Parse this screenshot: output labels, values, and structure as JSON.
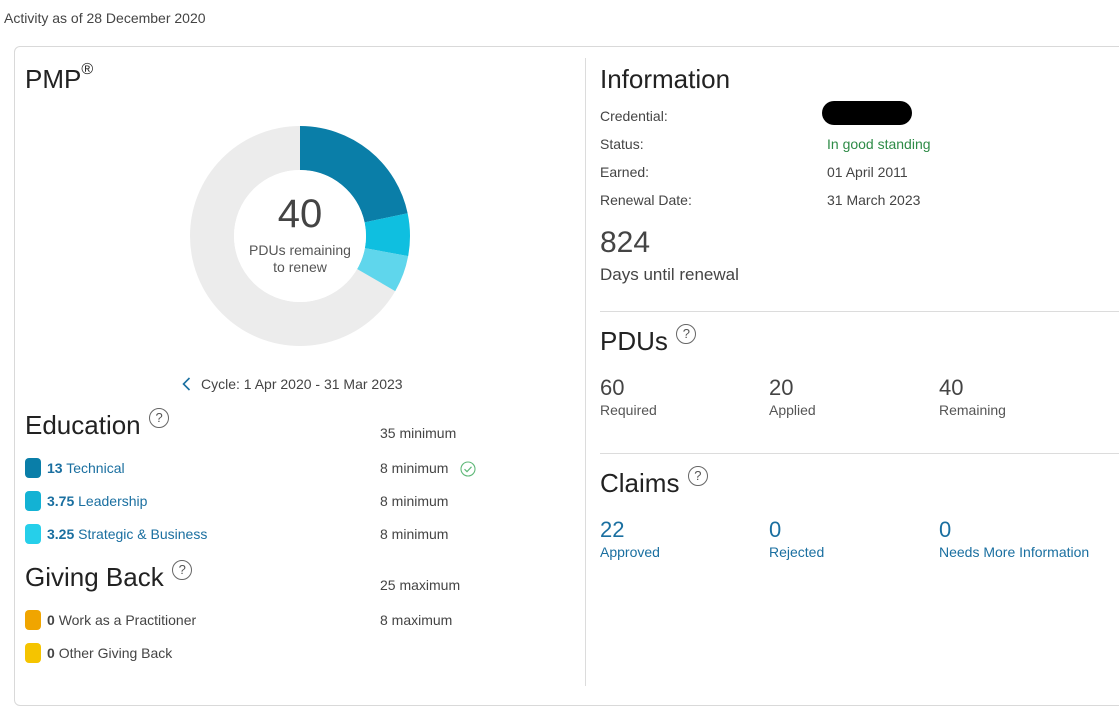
{
  "activity_text": "Activity as of 28 December 2020",
  "credential_card": {
    "title": "PMP",
    "title_mark": "®",
    "donut": {
      "remaining": "40",
      "remaining_label_line1": "PDUs remaining",
      "remaining_label_line2": "to renew",
      "segments": [
        {
          "name": "Technical",
          "value": 13,
          "color": "#0a7ea8"
        },
        {
          "name": "Leadership",
          "value": 3.75,
          "color": "#0fbfe0"
        },
        {
          "name": "Strategic & Business",
          "value": 3.25,
          "color": "#5fd6ec"
        }
      ],
      "total": 60,
      "track_color": "#ececec"
    },
    "cycle_text": "Cycle: 1 Apr 2020 - 31 Mar 2023"
  },
  "education": {
    "title": "Education",
    "help": "?",
    "summary": "35 minimum",
    "items": [
      {
        "value": "13",
        "label": "Technical",
        "requirement": "8 minimum",
        "color": "#0a7ea8",
        "met": true
      },
      {
        "value": "3.75",
        "label": "Leadership",
        "requirement": "8 minimum",
        "color": "#13b2d4",
        "met": false
      },
      {
        "value": "3.25",
        "label": "Strategic & Business",
        "requirement": "8 minimum",
        "color": "#26cfea",
        "met": false
      }
    ]
  },
  "giving_back": {
    "title": "Giving Back",
    "help": "?",
    "summary": "25 maximum",
    "items": [
      {
        "value": "0",
        "label": "Work as a Practitioner",
        "requirement": "8 maximum",
        "color": "#f0a500"
      },
      {
        "value": "0",
        "label": "Other Giving Back",
        "requirement": "",
        "color": "#f5c400"
      }
    ]
  },
  "information": {
    "title": "Information",
    "rows": [
      {
        "label": "Credential:",
        "value": ""
      },
      {
        "label": "Status:",
        "value": "In good standing"
      },
      {
        "label": "Earned:",
        "value": "01 April 2011"
      },
      {
        "label": "Renewal Date:",
        "value": "31 March 2023"
      }
    ],
    "days": "824",
    "days_label": "Days until renewal"
  },
  "pdus": {
    "title": "PDUs",
    "help": "?",
    "stats": [
      {
        "value": "60",
        "label": "Required"
      },
      {
        "value": "20",
        "label": "Applied"
      },
      {
        "value": "40",
        "label": "Remaining"
      }
    ]
  },
  "claims": {
    "title": "Claims",
    "help": "?",
    "stats": [
      {
        "value": "22",
        "label": "Approved"
      },
      {
        "value": "0",
        "label": "Rejected"
      },
      {
        "value": "0",
        "label": "Needs More Information"
      }
    ]
  }
}
